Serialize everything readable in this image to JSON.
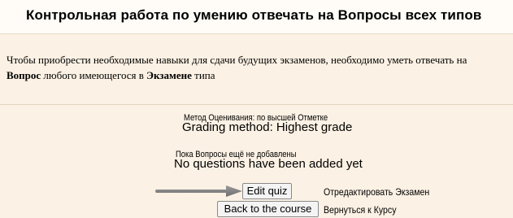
{
  "quiz": {
    "title": "Контрольная работа по умению отвечать на Вопросы всех типов",
    "intro": {
      "part1": "Чтобы приобрести необходимые навыки для сдачи будущих экзаменов, необходимо уметь отвечать на ",
      "bold1": "Вопрос",
      "part2": " любого имеющегося в ",
      "bold2": "Экзамене",
      "part3": " типа"
    },
    "grading_ru": "Метод Оценивания: по высшей Отметке",
    "grading_en": "Grading method: Highest grade",
    "no_questions_ru": "Пока Вопросы ещё не добавлены",
    "no_questions_en": "No questions have been added yet"
  },
  "actions": {
    "edit_label": "Edit quiz",
    "edit_caption": "Отредактировать Экзамен",
    "back_label": "Back to the course",
    "back_caption": "Вернуться к Курсу"
  },
  "colors": {
    "page_background": "#fbf1e4",
    "title_background": "#fffcf7",
    "arrow": "#7f7f7f"
  },
  "icons": {
    "pointer": "arrow-right-icon"
  }
}
